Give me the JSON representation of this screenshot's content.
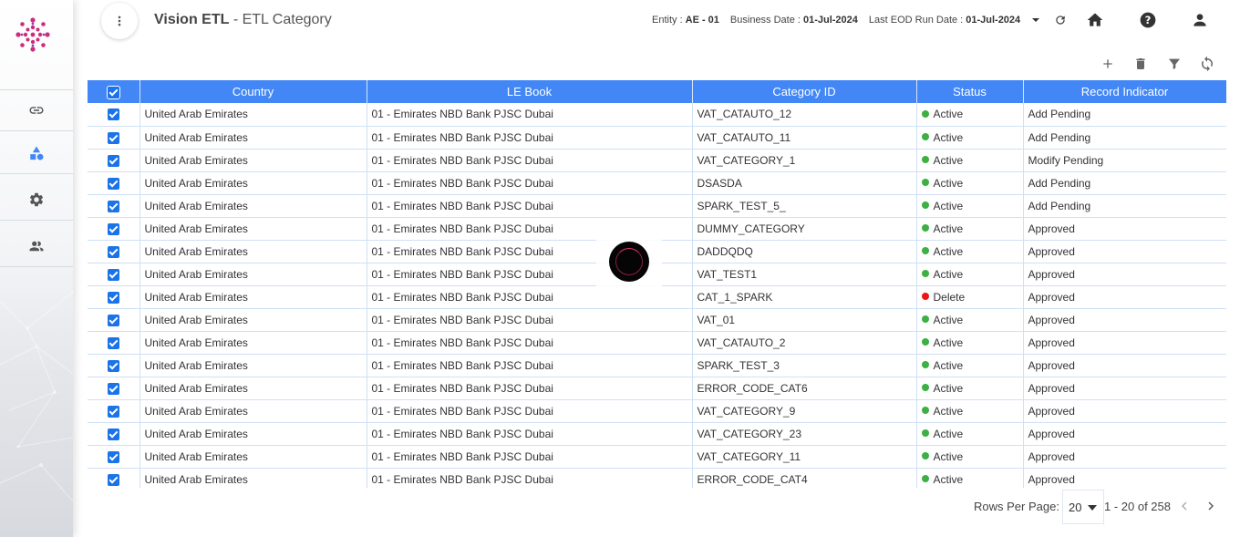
{
  "app": {
    "title_bold": "Vision ETL",
    "title_rest": " - ETL Category"
  },
  "header": {
    "entity_label": "Entity :",
    "entity_value": "AE - 01",
    "business_date_label": "Business Date :",
    "business_date_value": "01-Jul-2024",
    "last_eod_label": "Last EOD Run Date :",
    "last_eod_value": "01-Jul-2024",
    "icons": [
      "more-vert-icon",
      "chevron-down-icon",
      "refresh-icon",
      "home-icon",
      "help-icon",
      "account-icon"
    ]
  },
  "sidebar": {
    "items": [
      {
        "icon": "link-icon"
      },
      {
        "icon": "category-shapes-icon"
      },
      {
        "icon": "gear-icon"
      },
      {
        "icon": "users-icon"
      }
    ]
  },
  "toolbar": {
    "icons": [
      "add-icon",
      "delete-icon",
      "filter-icon",
      "sync-icon"
    ]
  },
  "table": {
    "columns": [
      "Country",
      "LE Book",
      "Category ID",
      "Status",
      "Record Indicator"
    ],
    "rows": [
      {
        "country": "United Arab Emirates",
        "le_book": "01 - Emirates NBD Bank PJSC Dubai",
        "category_id": "VAT_CATAUTO_12",
        "status": "Active",
        "record_indicator": "Add Pending"
      },
      {
        "country": "United Arab Emirates",
        "le_book": "01 - Emirates NBD Bank PJSC Dubai",
        "category_id": "VAT_CATAUTO_11",
        "status": "Active",
        "record_indicator": "Add Pending"
      },
      {
        "country": "United Arab Emirates",
        "le_book": "01 - Emirates NBD Bank PJSC Dubai",
        "category_id": "VAT_CATEGORY_1",
        "status": "Active",
        "record_indicator": "Modify Pending"
      },
      {
        "country": "United Arab Emirates",
        "le_book": "01 - Emirates NBD Bank PJSC Dubai",
        "category_id": "DSASDA",
        "status": "Active",
        "record_indicator": "Add Pending"
      },
      {
        "country": "United Arab Emirates",
        "le_book": "01 - Emirates NBD Bank PJSC Dubai",
        "category_id": "SPARK_TEST_5_",
        "status": "Active",
        "record_indicator": "Add Pending"
      },
      {
        "country": "United Arab Emirates",
        "le_book": "01 - Emirates NBD Bank PJSC Dubai",
        "category_id": "DUMMY_CATEGORY",
        "status": "Active",
        "record_indicator": "Approved"
      },
      {
        "country": "United Arab Emirates",
        "le_book": "01 - Emirates NBD Bank PJSC Dubai",
        "category_id": "DADDQDQ",
        "status": "Active",
        "record_indicator": "Approved"
      },
      {
        "country": "United Arab Emirates",
        "le_book": "01 - Emirates NBD Bank PJSC Dubai",
        "category_id": "VAT_TEST1",
        "status": "Active",
        "record_indicator": "Approved"
      },
      {
        "country": "United Arab Emirates",
        "le_book": "01 - Emirates NBD Bank PJSC Dubai",
        "category_id": "CAT_1_SPARK",
        "status": "Delete",
        "record_indicator": "Approved"
      },
      {
        "country": "United Arab Emirates",
        "le_book": "01 - Emirates NBD Bank PJSC Dubai",
        "category_id": "VAT_01",
        "status": "Active",
        "record_indicator": "Approved"
      },
      {
        "country": "United Arab Emirates",
        "le_book": "01 - Emirates NBD Bank PJSC Dubai",
        "category_id": "VAT_CATAUTO_2",
        "status": "Active",
        "record_indicator": "Approved"
      },
      {
        "country": "United Arab Emirates",
        "le_book": "01 - Emirates NBD Bank PJSC Dubai",
        "category_id": "SPARK_TEST_3",
        "status": "Active",
        "record_indicator": "Approved"
      },
      {
        "country": "United Arab Emirates",
        "le_book": "01 - Emirates NBD Bank PJSC Dubai",
        "category_id": "ERROR_CODE_CAT6",
        "status": "Active",
        "record_indicator": "Approved"
      },
      {
        "country": "United Arab Emirates",
        "le_book": "01 - Emirates NBD Bank PJSC Dubai",
        "category_id": "VAT_CATEGORY_9",
        "status": "Active",
        "record_indicator": "Approved"
      },
      {
        "country": "United Arab Emirates",
        "le_book": "01 - Emirates NBD Bank PJSC Dubai",
        "category_id": "VAT_CATEGORY_23",
        "status": "Active",
        "record_indicator": "Approved"
      },
      {
        "country": "United Arab Emirates",
        "le_book": "01 - Emirates NBD Bank PJSC Dubai",
        "category_id": "VAT_CATEGORY_11",
        "status": "Active",
        "record_indicator": "Approved"
      },
      {
        "country": "United Arab Emirates",
        "le_book": "01 - Emirates NBD Bank PJSC Dubai",
        "category_id": "ERROR_CODE_CAT4",
        "status": "Active",
        "record_indicator": "Approved"
      }
    ]
  },
  "status_colors": {
    "Active": "#3cb043",
    "Delete": "#f01515"
  },
  "pagination": {
    "rows_per_page_label": "Rows Per Page:",
    "rows_per_page_value": "20",
    "range_text": "1 - 20 of 258"
  },
  "colors": {
    "header_bg": "#4287f5",
    "checkbox": "#1a73e8"
  }
}
